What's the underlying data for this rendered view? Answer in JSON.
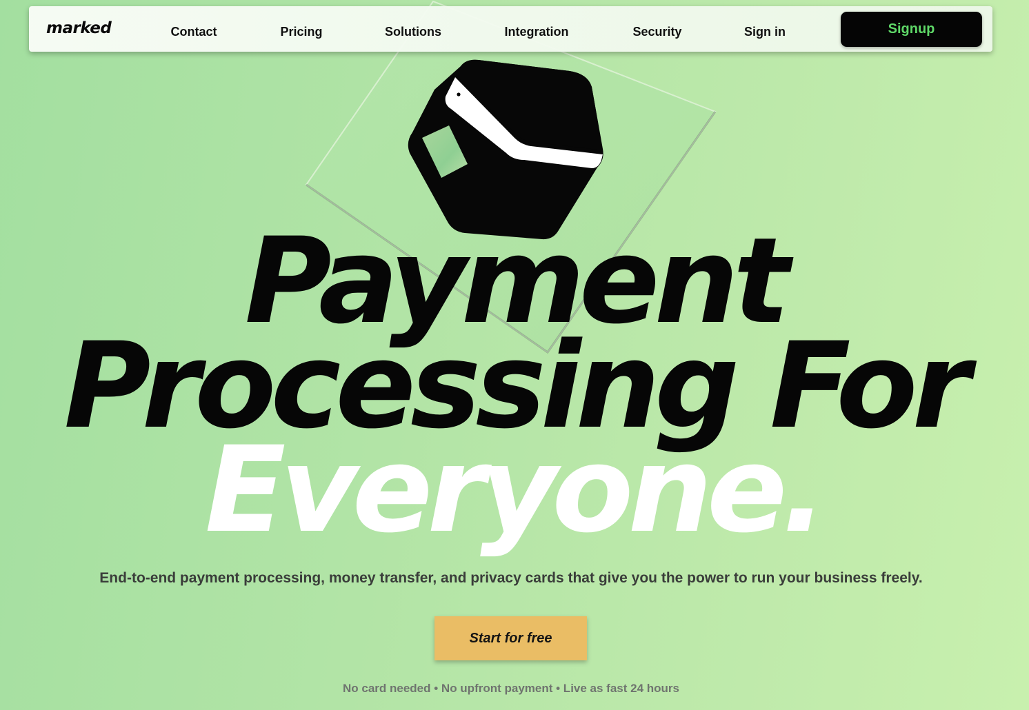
{
  "nav": {
    "logo": "marked",
    "links": [
      "Contact",
      "Pricing",
      "Solutions",
      "Integration",
      "Security",
      "Sign in"
    ],
    "signup_label": "Signup"
  },
  "hero": {
    "graphic_icon": "payment-terminal-icon",
    "headline_line1": "Payment",
    "headline_line2": "Processing For",
    "headline_line3": "Everyone.",
    "subtitle": "End-to-end payment processing, money transfer, and privacy cards that give you the power to run your business freely.",
    "cta_label": "Start for free",
    "footnote": "No card needed • No upfront payment • Live as fast 24 hours"
  },
  "colors": {
    "background_start": "#a3dfa0",
    "background_end": "#c8f0ae",
    "signup_text": "#5fd868",
    "cta_background": "#eabd65",
    "headline_dark": "#060606",
    "headline_light": "#ffffff"
  }
}
